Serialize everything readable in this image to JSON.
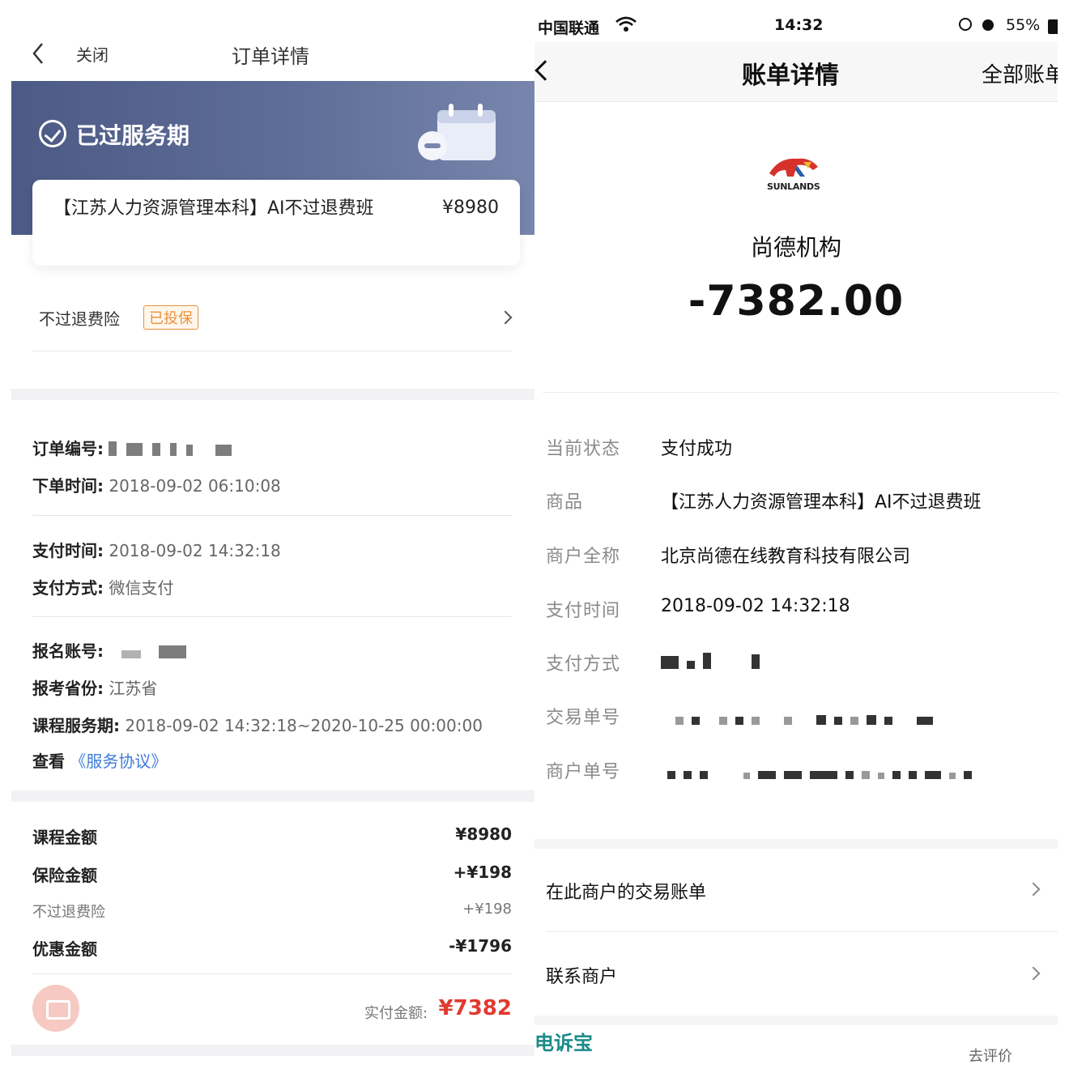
{
  "left": {
    "nav": {
      "close_label": "关闭",
      "title": "订单详情"
    },
    "header": {
      "status": "已过服务期"
    },
    "course": {
      "name": "【江苏人力资源管理本科】AI不过退费班",
      "price": "¥8980"
    },
    "insurance": {
      "label": "不过退费险",
      "badge": "已投保"
    },
    "order": {
      "order_no_label": "订单编号:",
      "order_time_label": "下单时间:",
      "order_time": "2018-09-02 06:10:08",
      "pay_time_label": "支付时间:",
      "pay_time": "2018-09-02 14:32:18",
      "pay_method_label": "支付方式:",
      "pay_method": "微信支付",
      "account_label": "报名账号:",
      "province_label": "报考省份:",
      "province": "江苏省",
      "service_period_label": "课程服务期:",
      "service_period": "2018-09-02 14:32:18~2020-10-25 00:00:00",
      "view_label": "查看",
      "agreement_link": "《服务协议》"
    },
    "amounts": {
      "course_label": "课程金额",
      "course": "¥8980",
      "insurance_label": "保险金额",
      "insurance": "+¥198",
      "insurance_item_label": "不过退费险",
      "insurance_item": "+¥198",
      "discount_label": "优惠金额",
      "discount": "-¥1796",
      "paid_label": "实付金额:",
      "paid": "¥7382"
    }
  },
  "right": {
    "status_bar": {
      "carrier": "中国联通",
      "time": "14:32",
      "battery": "55%"
    },
    "nav": {
      "title": "账单详情",
      "action": "全部账单"
    },
    "merchant": {
      "logo_text": "SUNLANDS",
      "name": "尚德机构",
      "amount": "-7382.00"
    },
    "details": {
      "status_label": "当前状态",
      "status": "支付成功",
      "product_label": "商品",
      "product": "【江苏人力资源管理本科】AI不过退费班",
      "merchant_label": "商户全称",
      "merchant_full": "北京尚德在线教育科技有限公司",
      "pay_time_label": "支付时间",
      "pay_time": "2018-09-02 14:32:18",
      "pay_method_label": "支付方式",
      "txn_label": "交易单号",
      "merchant_no_label": "商户单号"
    },
    "links": {
      "merchant_bills": "在此商户的交易账单",
      "contact": "联系商户"
    },
    "watermark": "电诉宝",
    "footer_hint": "去评价"
  },
  "colors": {
    "header_bg": "#4c5a85",
    "accent_red": "#e03a2f",
    "badge_orange": "#e8923a",
    "link_blue": "#3e7bd8"
  }
}
